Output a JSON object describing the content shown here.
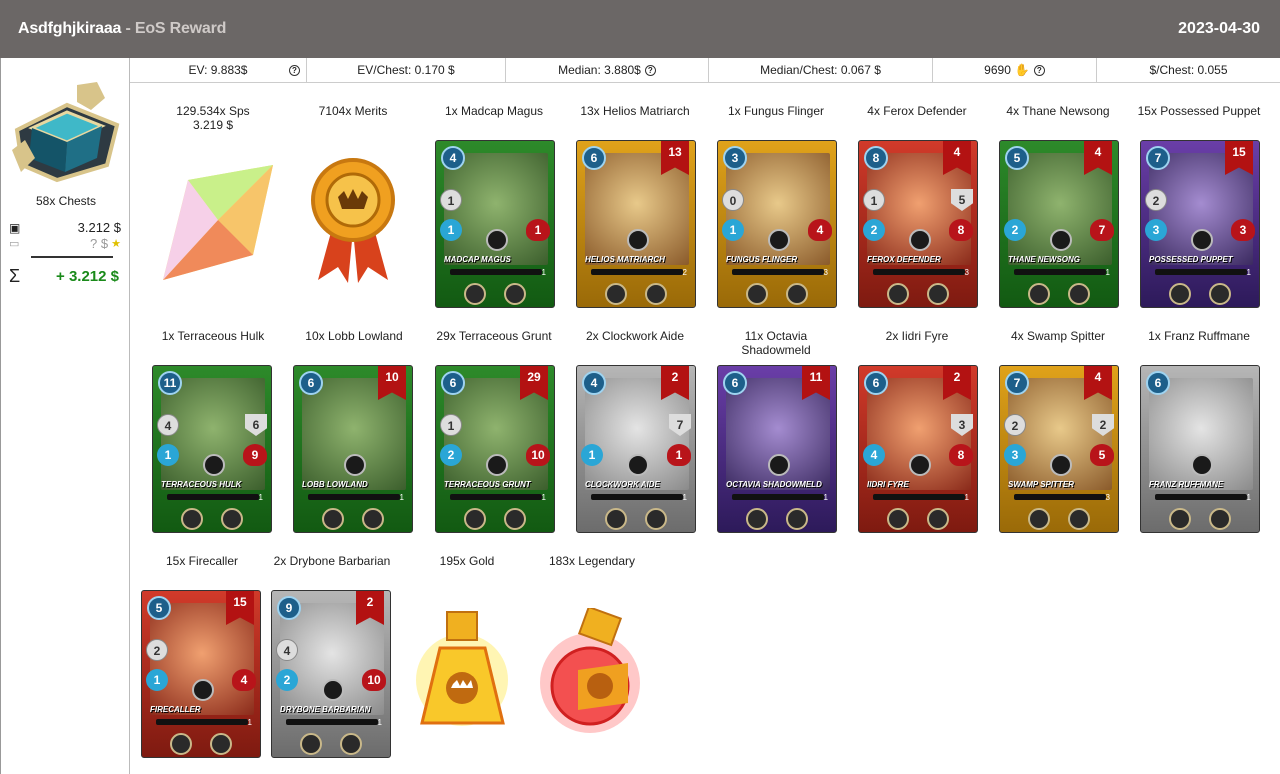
{
  "header": {
    "user": "Asdfghjkiraaa",
    "subtitle": "- EoS Reward",
    "date": "2023-04-30"
  },
  "sidebar": {
    "chests_label": "58x Chests",
    "value1": "3.212 $",
    "value2": "? $",
    "sum_symbol": "Σ",
    "total": "+ 3.212 $"
  },
  "stats": {
    "ev": "EV: 9.883$",
    "ev_chest": "EV/Chest: 0.170 $",
    "median": "Median: 3.880$",
    "median_chest": "Median/Chest: 0.067 $",
    "count": "9690",
    "per_chest": "$/Chest: 0.055"
  },
  "rewards": {
    "sps": {
      "label": "129.534x Sps",
      "sub": "3.219 $"
    },
    "merits": {
      "label": "7104x Merits"
    },
    "gold": {
      "label": "195x Gold"
    },
    "legendary": {
      "label": "183x Legendary"
    }
  },
  "cards": [
    {
      "label": "1x Madcap Magus",
      "name": "Madcap Magus",
      "mana": "4",
      "count": "",
      "atk": "1",
      "arm": "",
      "spd": "1",
      "hp": "1",
      "color": "green",
      "lvl": "1"
    },
    {
      "label": "13x Helios Matriarch",
      "name": "Helios Matriarch",
      "mana": "6",
      "count": "13",
      "atk": "",
      "arm": "",
      "spd": "",
      "hp": "",
      "color": "gold",
      "lvl": "2"
    },
    {
      "label": "1x Fungus Flinger",
      "name": "Fungus Flinger",
      "mana": "3",
      "count": "",
      "atk": "0",
      "arm": "",
      "spd": "1",
      "hp": "4",
      "color": "gold",
      "lvl": "3"
    },
    {
      "label": "4x Ferox Defender",
      "name": "Ferox Defender",
      "mana": "8",
      "count": "4",
      "atk": "1",
      "arm": "5",
      "spd": "2",
      "hp": "8",
      "color": "red",
      "lvl": "3"
    },
    {
      "label": "4x Thane Newsong",
      "name": "Thane Newsong",
      "mana": "5",
      "count": "4",
      "atk": "",
      "arm": "",
      "spd": "2",
      "hp": "7",
      "color": "green",
      "lvl": "1"
    },
    {
      "label": "15x Possessed Puppet",
      "name": "Possessed Puppet",
      "mana": "7",
      "count": "15",
      "atk": "2",
      "arm": "",
      "spd": "3",
      "hp": "3",
      "color": "purple",
      "lvl": "1"
    },
    {
      "label": "1x Terraceous Hulk",
      "name": "Terraceous Hulk",
      "mana": "11",
      "count": "",
      "atk": "4",
      "arm": "6",
      "spd": "1",
      "hp": "9",
      "color": "green",
      "lvl": "1"
    },
    {
      "label": "10x Lobb Lowland",
      "name": "Lobb Lowland",
      "mana": "6",
      "count": "10",
      "atk": "",
      "arm": "",
      "spd": "",
      "hp": "",
      "color": "green",
      "lvl": "1"
    },
    {
      "label": "29x Terraceous Grunt",
      "name": "Terraceous Grunt",
      "mana": "6",
      "count": "29",
      "atk": "1",
      "arm": "",
      "spd": "2",
      "hp": "10",
      "color": "green",
      "lvl": "1"
    },
    {
      "label": "2x Clockwork Aide",
      "name": "Clockwork Aide",
      "mana": "4",
      "count": "2",
      "atk": "",
      "arm": "7",
      "spd": "1",
      "hp": "1",
      "color": "grey",
      "lvl": "1"
    },
    {
      "label": "11x Octavia Shadowmeld",
      "name": "Octavia Shadowmeld",
      "mana": "6",
      "count": "11",
      "atk": "",
      "arm": "",
      "spd": "",
      "hp": "",
      "color": "purple",
      "lvl": "1"
    },
    {
      "label": "2x Iidri Fyre",
      "name": "Iidri Fyre",
      "mana": "6",
      "count": "2",
      "atk": "",
      "arm": "3",
      "spd": "4",
      "hp": "8",
      "color": "red",
      "lvl": "1"
    },
    {
      "label": "4x Swamp Spitter",
      "name": "Swamp Spitter",
      "mana": "7",
      "count": "4",
      "atk": "2",
      "arm": "2",
      "spd": "3",
      "hp": "5",
      "color": "gold",
      "lvl": "3"
    },
    {
      "label": "1x Franz Ruffmane",
      "name": "Franz Ruffmane",
      "mana": "6",
      "count": "",
      "atk": "",
      "arm": "",
      "spd": "",
      "hp": "",
      "color": "grey",
      "lvl": "1"
    },
    {
      "label": "15x Firecaller",
      "name": "Firecaller",
      "mana": "5",
      "count": "15",
      "atk": "2",
      "arm": "",
      "spd": "1",
      "hp": "4",
      "color": "red",
      "lvl": "1"
    },
    {
      "label": "2x Drybone Barbarian",
      "name": "Drybone Barbarian",
      "mana": "9",
      "count": "2",
      "atk": "4",
      "arm": "",
      "spd": "2",
      "hp": "10",
      "color": "grey",
      "lvl": "1"
    }
  ]
}
